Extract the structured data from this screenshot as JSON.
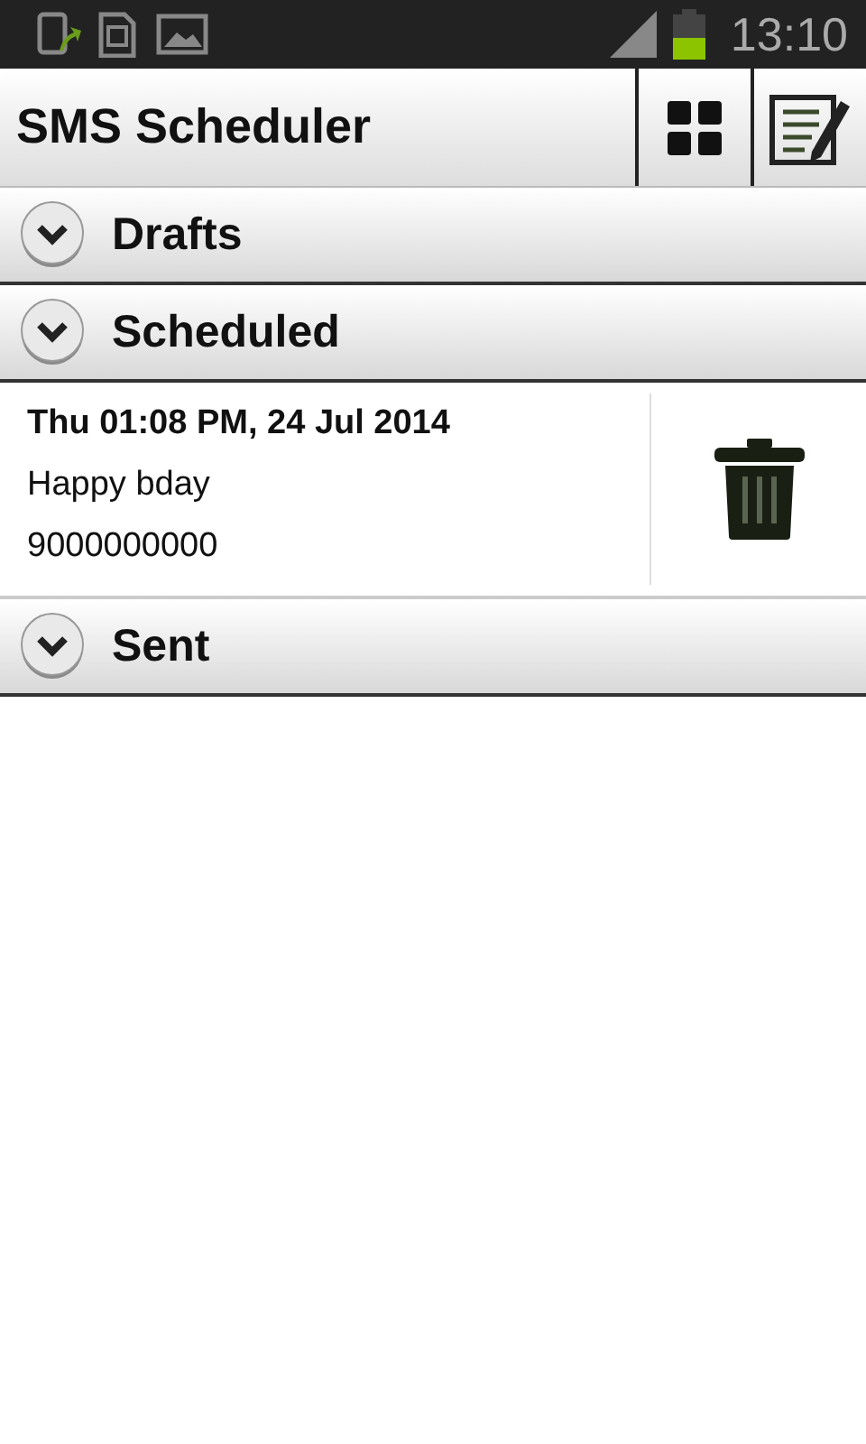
{
  "status_bar": {
    "time": "13:10"
  },
  "action_bar": {
    "title": "SMS Scheduler"
  },
  "sections": [
    {
      "label": "Drafts"
    },
    {
      "label": "Scheduled",
      "messages": [
        {
          "when": "Thu 01:08 PM, 24 Jul 2014",
          "text": "Happy bday",
          "recipient": "9000000000"
        }
      ]
    },
    {
      "label": "Sent"
    }
  ]
}
